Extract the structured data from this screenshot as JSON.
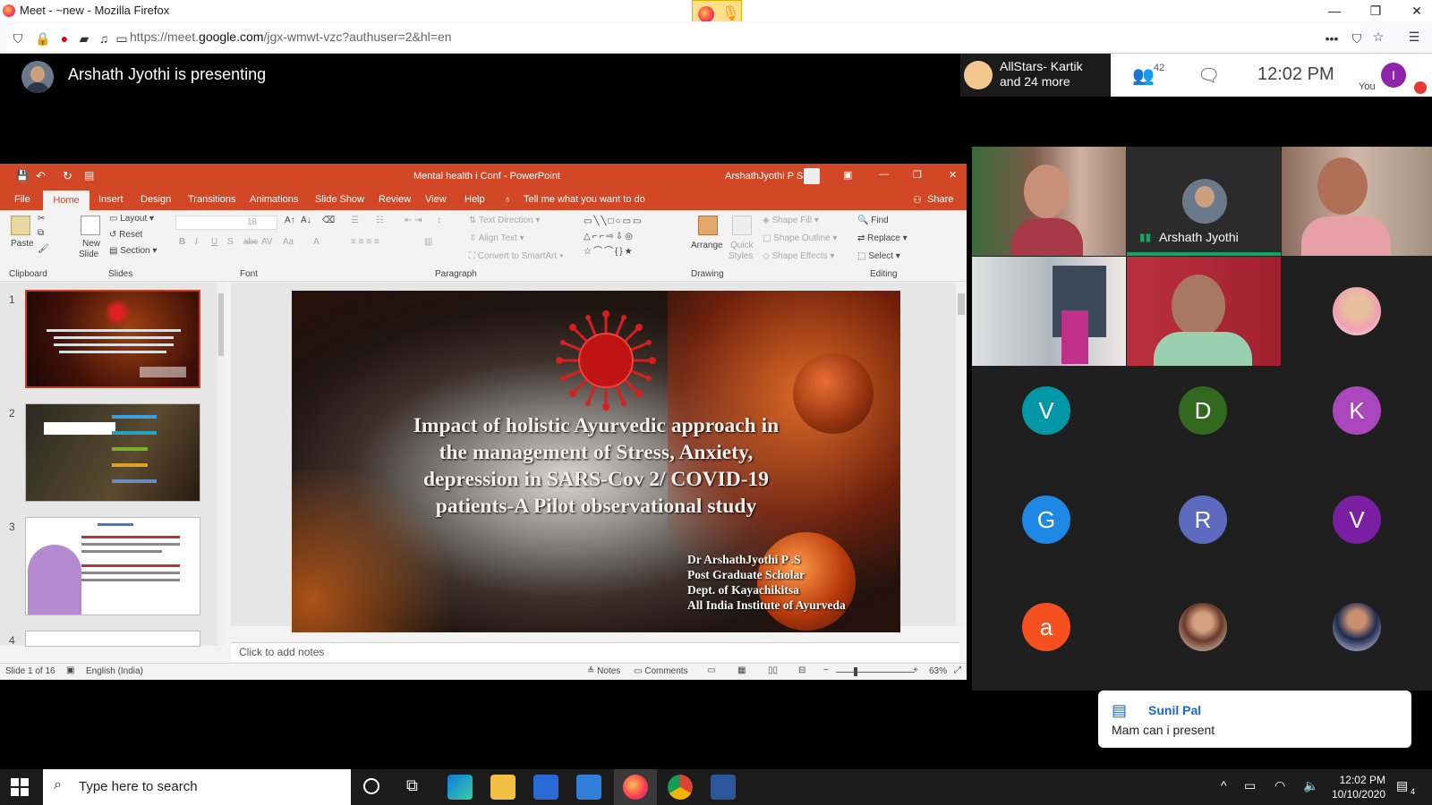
{
  "browser": {
    "window_title": "Meet - ~new - Mozilla Firefox",
    "url_prefix": "https://meet.",
    "url_domain": "google.com",
    "url_rest": "/jgx-wmwt-vzc?authuser=2&hl=en"
  },
  "meet": {
    "presenting": "Arshath Jyothi is presenting",
    "others_line1": "AllStars- Kartik",
    "others_line2": "and 24 more",
    "people_count": "42",
    "time": "12:02 PM",
    "you_initial": "I",
    "you_label": "You",
    "tiles": [
      {
        "type": "video",
        "name": ""
      },
      {
        "type": "avatar",
        "name": "Arshath Jyothi"
      },
      {
        "type": "video",
        "name": ""
      },
      {
        "type": "video",
        "name": ""
      },
      {
        "type": "video",
        "name": ""
      },
      {
        "type": "photo",
        "name": ""
      },
      {
        "type": "letter",
        "letter": "V",
        "color": "#0097a7"
      },
      {
        "type": "letter",
        "letter": "D",
        "color": "#33691e"
      },
      {
        "type": "letter",
        "letter": "K",
        "color": "#ab47bc"
      },
      {
        "type": "letter",
        "letter": "G",
        "color": "#1e88e5"
      },
      {
        "type": "letter",
        "letter": "R",
        "color": "#5c6bc0"
      },
      {
        "type": "letter",
        "letter": "V",
        "color": "#7b1fa2"
      },
      {
        "type": "letter",
        "letter": "a",
        "color": "#f4511e"
      },
      {
        "type": "photo",
        "name": ""
      },
      {
        "type": "photo",
        "name": ""
      }
    ],
    "chat_popup": {
      "name": "Sunil Pal",
      "message": "Mam can i present"
    }
  },
  "powerpoint": {
    "title": "Mental health i Conf  -  PowerPoint",
    "user": "ArshathJyothi P S",
    "tabs": [
      "File",
      "Home",
      "Insert",
      "Design",
      "Transitions",
      "Animations",
      "Slide Show",
      "Review",
      "View",
      "Help"
    ],
    "tell_me": "Tell me what you want to do",
    "share": "Share",
    "ribbon": {
      "paste": "Paste",
      "new_slide_1": "New",
      "new_slide_2": "Slide",
      "layout": "Layout",
      "reset": "Reset",
      "section": "Section",
      "font_size": "18",
      "text_direction": "Text Direction",
      "align_text": "Align Text",
      "convert_smartart": "Convert to SmartArt",
      "arrange": "Arrange",
      "quick_styles_1": "Quick",
      "quick_styles_2": "Styles",
      "shape_fill": "Shape Fill",
      "shape_outline": "Shape Outline",
      "shape_effects": "Shape Effects",
      "find": "Find",
      "replace": "Replace",
      "select": "Select",
      "groups": [
        "Clipboard",
        "Slides",
        "Font",
        "Paragraph",
        "Drawing",
        "Editing"
      ]
    },
    "thumb_numbers": [
      "1",
      "2",
      "3",
      "4"
    ],
    "slide": {
      "title_lines": [
        "Impact of holistic Ayurvedic approach in",
        "the management of Stress, Anxiety,",
        "depression in SARS-Cov 2/ COVID-19",
        "patients-A Pilot observational study"
      ],
      "author_lines": [
        "Dr ArshathJyothi P .S",
        "Post Graduate Scholar",
        "Dept. of Kayachikitsa",
        "All India Institute of Ayurveda"
      ]
    },
    "notes_placeholder": "Click to add notes",
    "status": {
      "slide_of": "Slide 1 of 16",
      "language": "English (India)",
      "notes": "Notes",
      "comments": "Comments",
      "zoom": "63%"
    }
  },
  "taskbar": {
    "search_placeholder": "Type here to search",
    "time": "12:02 PM",
    "date": "10/10/2020",
    "notif_count": "4"
  }
}
